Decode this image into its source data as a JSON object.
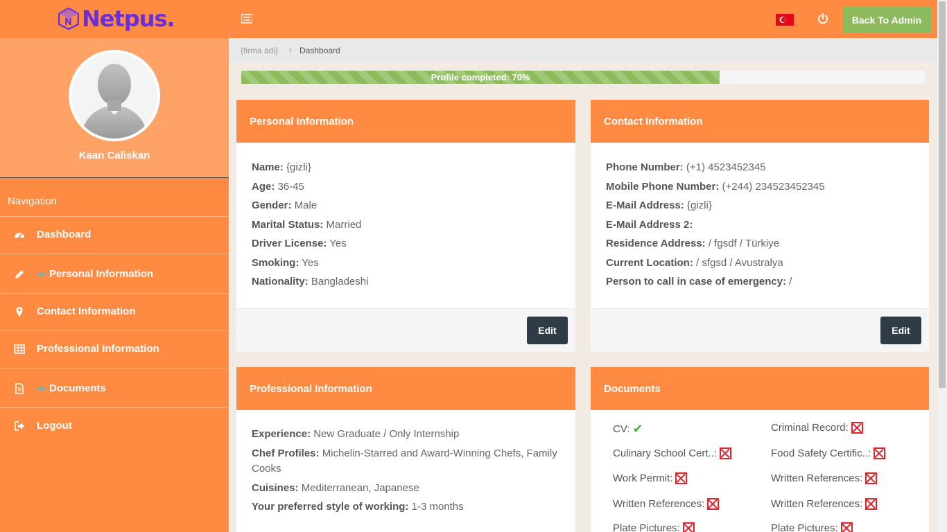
{
  "header": {
    "logo_text": "Netpus.",
    "logo_mark": "N",
    "back_button": "Back To Admin",
    "brand_color": "#6a2fd6",
    "accent_color": "#ff8a42"
  },
  "sidebar": {
    "user_name": "Kaan Caliskan",
    "nav_title": "Navigation",
    "items": [
      {
        "label": "Dashboard",
        "icon": "dashboard-icon",
        "marker": ""
      },
      {
        "label": "Personal Information",
        "icon": "pencil-icon",
        "marker": ">>"
      },
      {
        "label": "Contact Information",
        "icon": "map-pin-icon",
        "marker": ""
      },
      {
        "label": "Professional Information",
        "icon": "table-icon",
        "marker": ""
      },
      {
        "label": "Documents",
        "icon": "document-icon",
        "marker": ">>"
      },
      {
        "label": "Logout",
        "icon": "logout-icon",
        "marker": ""
      }
    ]
  },
  "breadcrumb": {
    "root": "{firma adi}",
    "separator": "›",
    "current": "Dashboard"
  },
  "progress": {
    "label": "Profile completed: 70%",
    "value": 0.7
  },
  "personal": {
    "title": "Personal Information",
    "rows": [
      {
        "k": "Name:",
        "v": "{gizli}"
      },
      {
        "k": "Age:",
        "v": "36-45"
      },
      {
        "k": "Gender:",
        "v": "Male"
      },
      {
        "k": "Marital Status:",
        "v": "Married"
      },
      {
        "k": "Driver License:",
        "v": "Yes"
      },
      {
        "k": "Smoking:",
        "v": "Yes"
      },
      {
        "k": "Nationality:",
        "v": "Bangladeshi"
      }
    ],
    "edit": "Edit"
  },
  "contact": {
    "title": "Contact Information",
    "rows": [
      {
        "k": "Phone Number:",
        "v": "(+1) 4523452345"
      },
      {
        "k": "Mobile Phone Number:",
        "v": "(+244) 234523452345"
      },
      {
        "k": "E-Mail Address:",
        "v": "{gizli}"
      },
      {
        "k": "E-Mail Address 2:",
        "v": ""
      },
      {
        "k": "Residence Address:",
        "v": "/ fgsdf / Türkiye"
      },
      {
        "k": "Current Location:",
        "v": "/ sfgsd / Avustralya"
      },
      {
        "k": "Person to call in case of emergency:",
        "v": "/"
      }
    ],
    "edit": "Edit"
  },
  "professional": {
    "title": "Professional Information",
    "rows": [
      {
        "k": "Experience:",
        "v": "New Graduate / Only Internship"
      },
      {
        "k": "Chef Profiles:",
        "v": "Michelin-Starred and Award-Winning Chefs, Family Cooks"
      },
      {
        "k": "Cuisines:",
        "v": "Mediterranean, Japanese"
      },
      {
        "k": "Your preferred style of working:",
        "v": "1-3 months"
      }
    ]
  },
  "documents": {
    "title": "Documents",
    "items": [
      {
        "label": "CV:",
        "status": "ok"
      },
      {
        "label": "Criminal Record:",
        "status": "missing"
      },
      {
        "label": "Culinary School Cert..:",
        "status": "missing"
      },
      {
        "label": "Food Safety Certific..:",
        "status": "missing"
      },
      {
        "label": "Work Permit:",
        "status": "missing"
      },
      {
        "label": "Written References:",
        "status": "missing"
      },
      {
        "label": "Written References:",
        "status": "missing"
      },
      {
        "label": "Written References:",
        "status": "missing"
      },
      {
        "label": "Plate Pictures:",
        "status": "missing"
      },
      {
        "label": "Plate Pictures:",
        "status": "missing"
      }
    ]
  }
}
